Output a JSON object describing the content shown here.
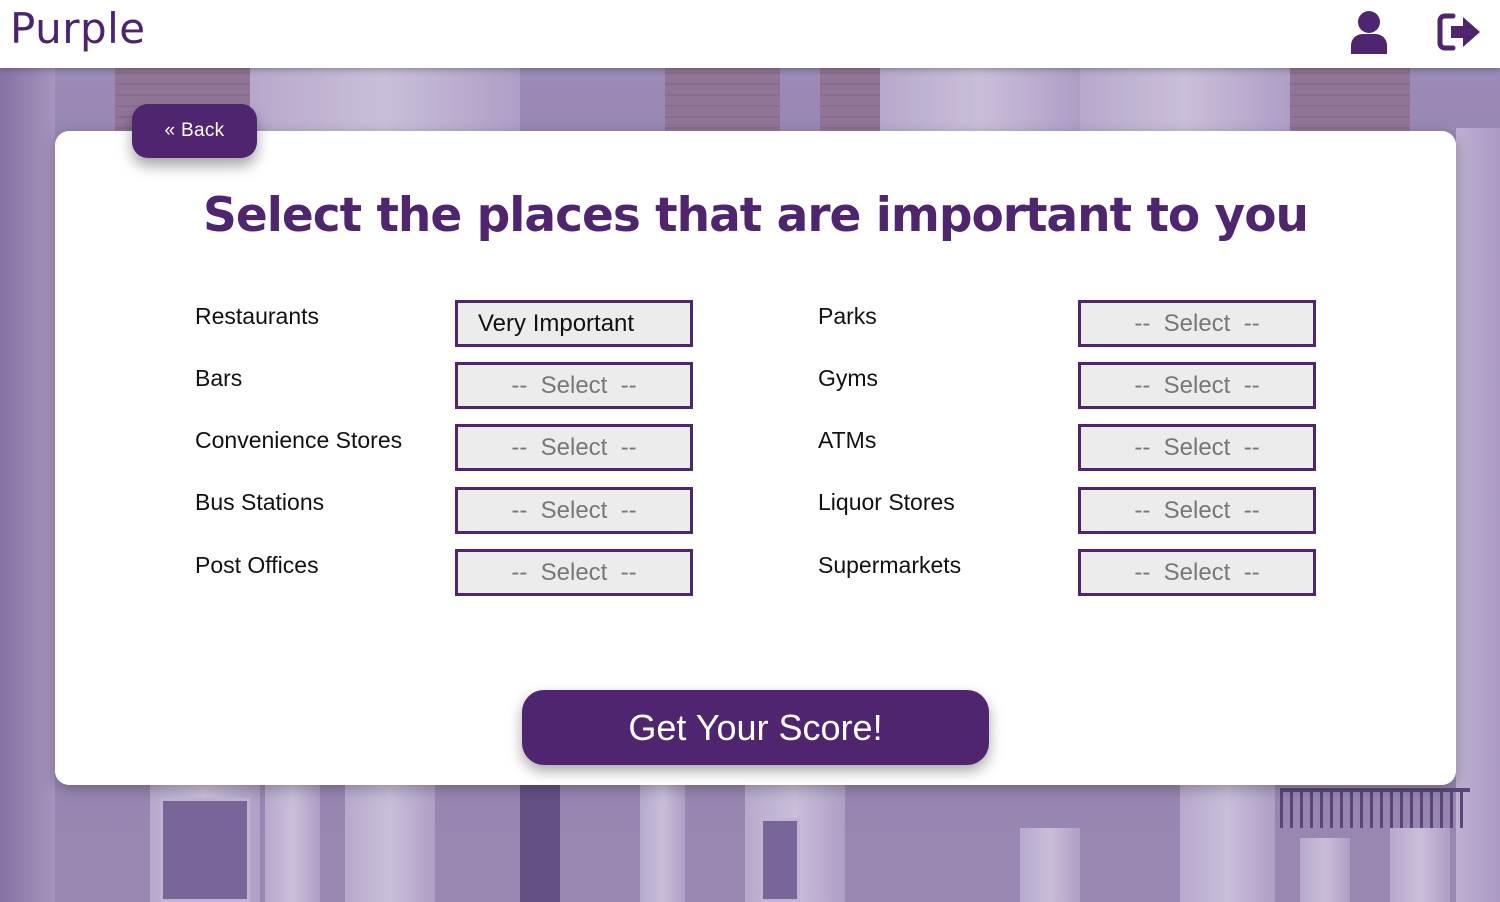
{
  "header": {
    "brand": "Purple",
    "profile_icon": "user-icon",
    "logout_icon": "sign-out-icon"
  },
  "back_label": "« Back",
  "heading": "Select the places that are important to you",
  "left_rows": [
    {
      "label": "Restaurants",
      "value": "Very Important"
    },
    {
      "label": "Bars",
      "value": "--  Select  --"
    },
    {
      "label": "Convenience Stores",
      "value": "--  Select  --"
    },
    {
      "label": "Bus Stations",
      "value": "--  Select  --"
    },
    {
      "label": "Post Offices",
      "value": "--  Select  --"
    }
  ],
  "right_rows": [
    {
      "label": "Parks",
      "value": "--  Select  --"
    },
    {
      "label": "Gyms",
      "value": "--  Select  --"
    },
    {
      "label": "ATMs",
      "value": "--  Select  --"
    },
    {
      "label": "Liquor Stores",
      "value": "--  Select  --"
    },
    {
      "label": "Supermarkets",
      "value": "--  Select  --"
    }
  ],
  "submit_label": "Get Your Score!",
  "colors": {
    "accent": "#4f2570",
    "select_bg": "#ececec"
  }
}
